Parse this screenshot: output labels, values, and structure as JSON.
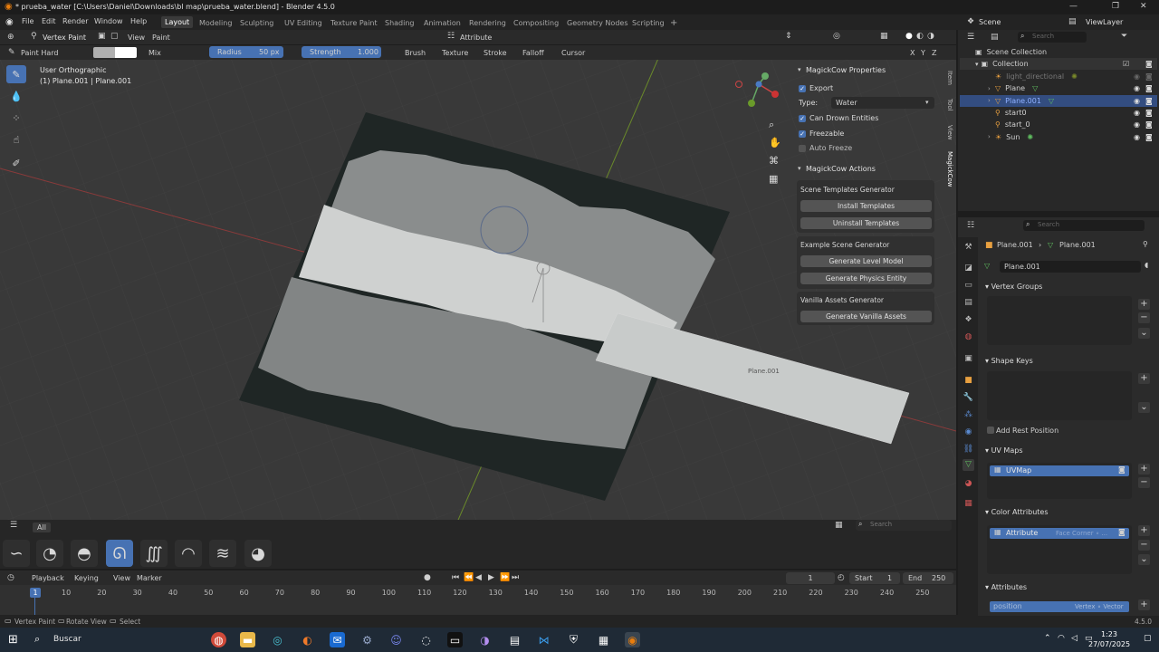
{
  "titlebar": {
    "title": "* prueba_water [C:\\Users\\Daniel\\Downloads\\bl map\\prueba_water.blend] - Blender 4.5.0",
    "min": "—",
    "max": "❐",
    "close": "✕"
  },
  "menu": [
    "File",
    "Edit",
    "Render",
    "Window",
    "Help"
  ],
  "workspaces": [
    "Layout",
    "Modeling",
    "Sculpting",
    "UV Editing",
    "Texture Paint",
    "Shading",
    "Animation",
    "Rendering",
    "Compositing",
    "Geometry Nodes",
    "Scripting",
    "+"
  ],
  "scene": {
    "label": "Scene",
    "viewlayer": "ViewLayer"
  },
  "header": {
    "mode": "Vertex Paint",
    "view": "View",
    "paint": "Paint",
    "attribute": "Attribute"
  },
  "toolsettings": {
    "brush": "Paint Hard",
    "blend": "Mix",
    "radius_label": "Radius",
    "radius_value": "50 px",
    "strength_label": "Strength",
    "strength_value": "1.000",
    "brush_menu": "Brush",
    "texture_menu": "Texture",
    "stroke_menu": "Stroke",
    "falloff_menu": "Falloff",
    "cursor_menu": "Cursor",
    "axes": [
      "X",
      "Y",
      "Z"
    ]
  },
  "viewport": {
    "view_name": "User Orthographic",
    "object_info": "(1) Plane.001 | Plane.001",
    "object_label": "Plane.001"
  },
  "npanel": {
    "props_title": "MagickCow Properties",
    "export": "Export",
    "type_label": "Type:",
    "type_value": "Water",
    "can_drown": "Can Drown Entities",
    "freezable": "Freezable",
    "auto_freeze": "Auto Freeze",
    "actions_title": "MagickCow Actions",
    "scene_templates": "Scene Templates Generator",
    "install": "Install Templates",
    "uninstall": "Uninstall Templates",
    "example_gen": "Example Scene Generator",
    "gen_level": "Generate Level Model",
    "gen_physics": "Generate Physics Entity",
    "vanilla_gen": "Vanilla Assets Generator",
    "gen_vanilla": "Generate Vanilla Assets",
    "tabs": [
      "Item",
      "Tool",
      "View",
      "MagickCow"
    ]
  },
  "brushbar": {
    "menu": "All",
    "search_placeholder": "Search"
  },
  "timeline": {
    "playback": "Playback",
    "keying": "Keying",
    "view": "View",
    "marker": "Marker",
    "current_frame": "1",
    "start_label": "Start",
    "start": "1",
    "end_label": "End",
    "end": "250",
    "ticks": [
      "1",
      "10",
      "20",
      "30",
      "40",
      "50",
      "60",
      "70",
      "80",
      "90",
      "100",
      "110",
      "120",
      "130",
      "140",
      "150",
      "160",
      "170",
      "180",
      "190",
      "200",
      "210",
      "220",
      "230",
      "240",
      "250"
    ]
  },
  "status": {
    "left": "Vertex Paint",
    "mid": "Rotate View",
    "right": "Select",
    "version": "4.5.0"
  },
  "outliner": {
    "search_placeholder": "Search",
    "collection_root": "Scene Collection",
    "collection": "Collection",
    "items": [
      "light_directional",
      "Plane",
      "Plane.001",
      "start0",
      "start_0",
      "Sun"
    ]
  },
  "properties": {
    "search_placeholder": "Search",
    "breadcrumb_obj": "Plane.001",
    "breadcrumb_data": "Plane.001",
    "mesh_name": "Plane.001",
    "vertex_groups": "Vertex Groups",
    "shape_keys": "Shape Keys",
    "add_rest": "Add Rest Position",
    "uv_maps": "UV Maps",
    "uvmap": "UVMap",
    "color_attrs": "Color Attributes",
    "attr_name": "Attribute",
    "attr_domain": "Face Corner ∘ ...",
    "attributes": "Attributes",
    "position": "position",
    "position_domain": "Vertex ∘ Vector"
  },
  "taskbar": {
    "search": "Buscar",
    "time": "1:23",
    "date": "27/07/2025"
  }
}
